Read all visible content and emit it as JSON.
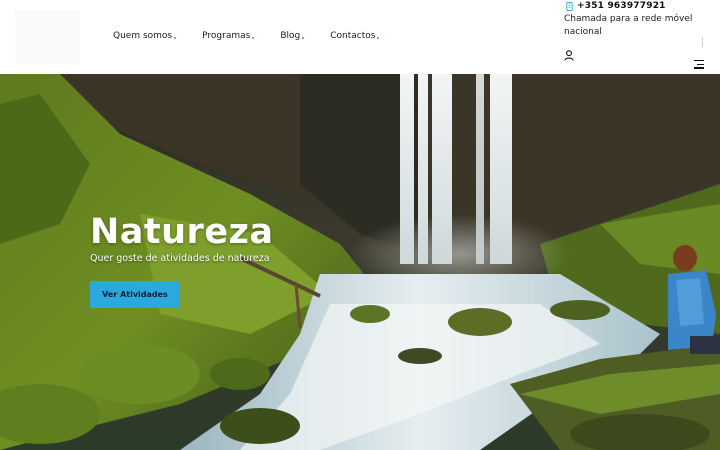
{
  "header": {
    "logo": "logo",
    "nav": [
      {
        "label": "Quem somos"
      },
      {
        "label": "Programas"
      },
      {
        "label": "Blog"
      },
      {
        "label": "Contactos"
      }
    ],
    "contact": {
      "phone": "+351 963977921",
      "note": "Chamada para a rede móvel nacional"
    },
    "icons": {
      "phone": "phone-icon",
      "user": "user-icon",
      "menu": "menu-icon"
    }
  },
  "hero": {
    "title": "Natureza",
    "subtitle": "Quer goste de atividades de natureza",
    "button": "Ver Atividades"
  },
  "colors": {
    "accent": "#2ba8dd",
    "nav_dot": "#2aa7d8"
  }
}
